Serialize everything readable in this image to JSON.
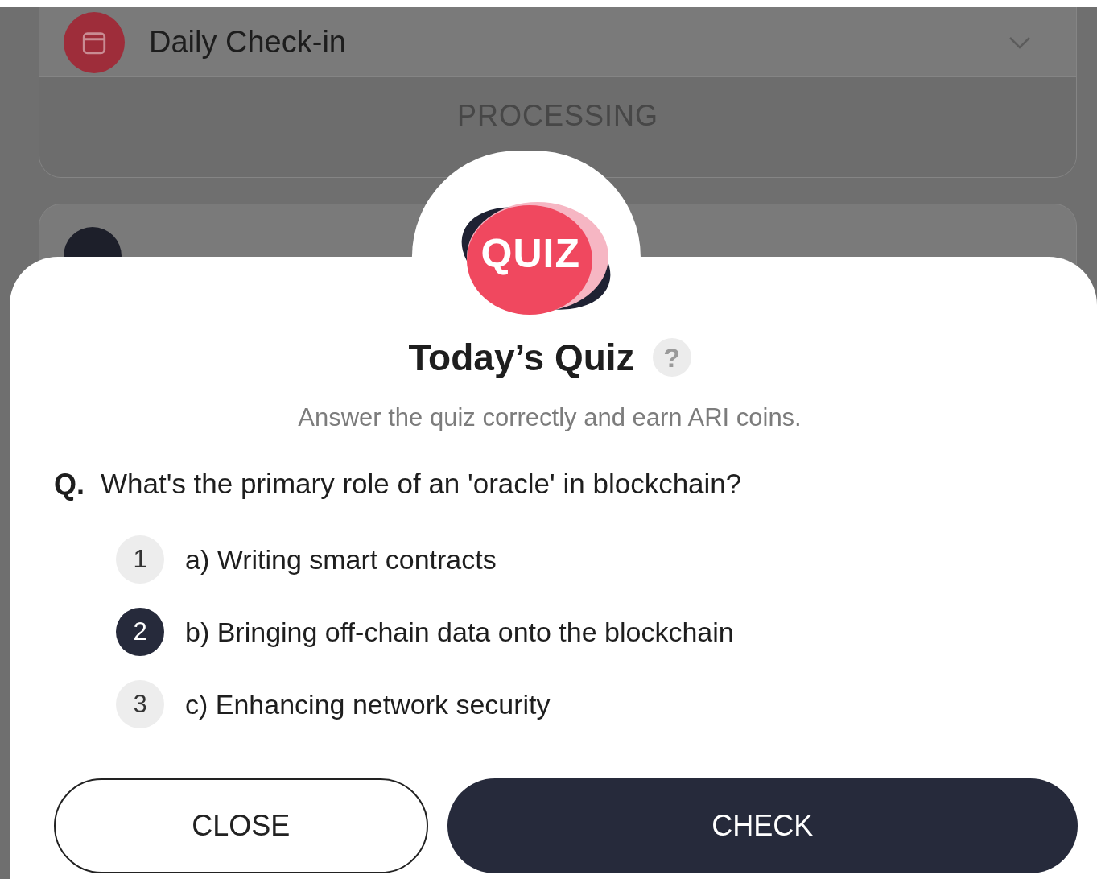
{
  "background_card": {
    "title": "Daily Check-in",
    "status": "PROCESSING"
  },
  "quiz": {
    "logo": "QUIZ",
    "title": "Today’s Quiz",
    "help": "?",
    "subtitle": "Answer the quiz correctly and earn ARI coins.",
    "question_prefix": "Q.",
    "question": "What's the primary role of an 'oracle' in blockchain?",
    "options": [
      {
        "number": "1",
        "text": "a) Writing smart contracts",
        "selected": false
      },
      {
        "number": "2",
        "text": "b) Bringing off-chain data onto the blockchain",
        "selected": true
      },
      {
        "number": "3",
        "text": "c) Enhancing network security",
        "selected": false
      }
    ],
    "buttons": [
      {
        "label": "CLOSE",
        "kind": "secondary"
      },
      {
        "label": "CHECK",
        "kind": "primary"
      }
    ]
  }
}
